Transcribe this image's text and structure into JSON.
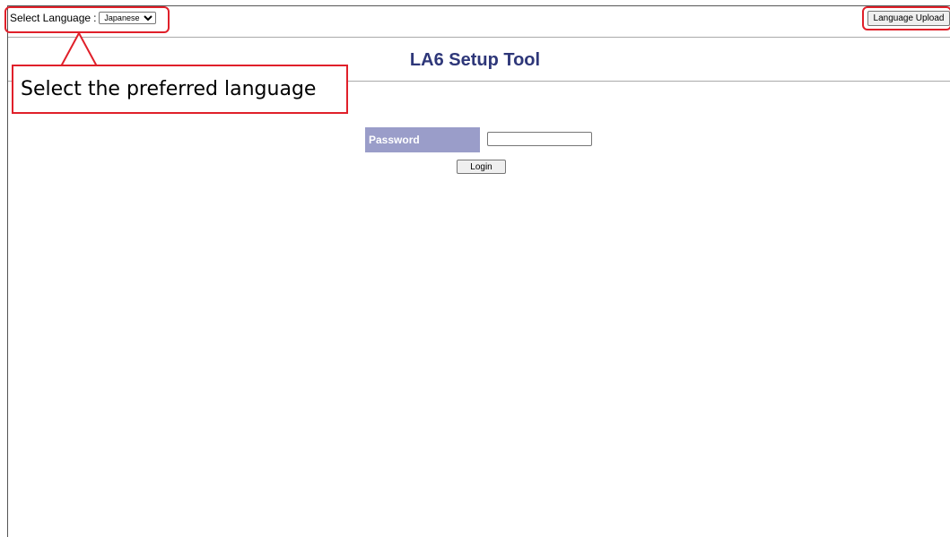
{
  "header": {
    "language_label": "Select Language",
    "language_separator": ":",
    "language_selected": "Japanese",
    "language_upload_label": "Language Upload"
  },
  "main": {
    "title": "LA6 Setup Tool",
    "password_label": "Password",
    "password_value": "",
    "login_label": "Login"
  },
  "annotation": {
    "callout_text": "Select the preferred language",
    "highlight_color": "#e0202a"
  },
  "colors": {
    "title": "#2e3779",
    "password_label_bg": "#9a9dc9"
  }
}
